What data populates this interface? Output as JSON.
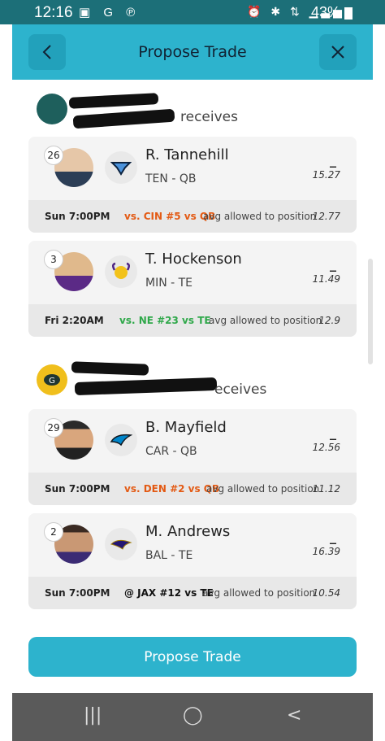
{
  "status_bar": {
    "time": "12:16",
    "left_icons": [
      "image-icon",
      "google-icon",
      "pinterest-icon"
    ],
    "right_icons": [
      "alarm-icon",
      "bluetooth-icon",
      "4g-icon",
      "signal-icon"
    ],
    "battery": "43%"
  },
  "header": {
    "title": "Propose Trade",
    "back_icon": "chevron-left-icon",
    "close_icon": "close-icon"
  },
  "sections": [
    {
      "team_label": "receives",
      "logo_color": "#1e5f5c",
      "players": [
        {
          "rank": "26",
          "name": "R. Tannehill",
          "position": "TEN - QB",
          "team_logo": "TEN",
          "dash": "–",
          "score": "15.27",
          "game_time": "Sun 7:00PM",
          "matchup": "vs. CIN #5 vs QB",
          "matchup_color": "#e35a14",
          "avg_label": "avg allowed to position",
          "avg_value": "12.77"
        },
        {
          "rank": "3",
          "name": "T. Hockenson",
          "position": "MIN - TE",
          "team_logo": "MIN",
          "dash": "–",
          "score": "11.49",
          "game_time": "Fri 2:20AM",
          "matchup": "vs. NE #23 vs TE",
          "matchup_color": "#2fa84a",
          "avg_label": "avg allowed to position",
          "avg_value": "12.9"
        }
      ]
    },
    {
      "team_label": "eceives",
      "logo_color": "#f0bf1c",
      "players": [
        {
          "rank": "29",
          "name": "B. Mayfield",
          "position": "CAR - QB",
          "team_logo": "CAR",
          "dash": "–",
          "score": "12.56",
          "game_time": "Sun 7:00PM",
          "matchup": "vs. DEN #2 vs QB",
          "matchup_color": "#e35a14",
          "avg_label": "avg allowed to position",
          "avg_value": "11.12"
        },
        {
          "rank": "2",
          "name": "M. Andrews",
          "position": "BAL - TE",
          "team_logo": "BAL",
          "dash": "–",
          "score": "16.39",
          "game_time": "Sun 7:00PM",
          "matchup": "@ JAX #12 vs TE",
          "matchup_color": "#111111",
          "avg_label": "avg allowed to position",
          "avg_value": "10.54"
        }
      ]
    }
  ],
  "propose_button": "Propose Trade",
  "nav": {
    "recents": "|||",
    "home": "◯",
    "back": "<"
  }
}
